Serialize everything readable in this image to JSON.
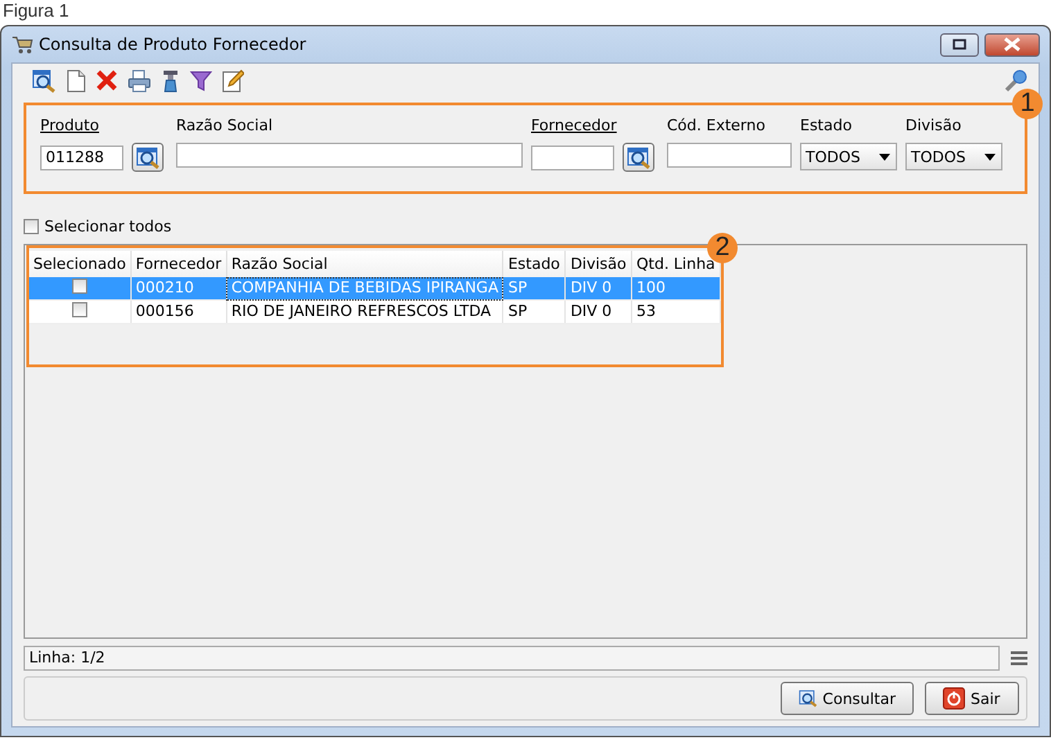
{
  "caption": "Figura 1",
  "window": {
    "title": "Consulta de Produto Fornecedor"
  },
  "filters": {
    "callout": "1",
    "fields": [
      {
        "kind": "lookup",
        "label": "Produto",
        "value": "011288"
      },
      {
        "kind": "text",
        "label": "Razão Social"
      },
      {
        "kind": "lookup",
        "label": "Fornecedor"
      },
      {
        "kind": "text",
        "label": "Cód. Externo"
      },
      {
        "kind": "select",
        "label": "Estado",
        "value": "TODOS"
      },
      {
        "kind": "select",
        "label": "Divisão",
        "value": "TODOS"
      }
    ]
  },
  "select_all": {
    "label": "Selecionar todos",
    "checked": false
  },
  "table": {
    "callout": "2",
    "columns": [
      "Selecionado",
      "Fornecedor",
      "Razão Social",
      "Estado",
      "Divisão",
      "Qtd. Linha"
    ],
    "rows": [
      {
        "selected": true,
        "checked": false,
        "cells": [
          "",
          "000210",
          "COMPANHIA DE BEBIDAS IPIRANGA",
          "SP",
          "DIV 0",
          "100"
        ]
      },
      {
        "selected": false,
        "checked": false,
        "cells": [
          "",
          "000156",
          "RIO DE JANEIRO REFRESCOS LTDA",
          "SP",
          "DIV 0",
          "53"
        ]
      }
    ]
  },
  "status_bar": "Linha: 1/2",
  "buttons": [
    {
      "kind": "search",
      "label": "Consultar"
    },
    {
      "kind": "exit",
      "label": "Sair"
    }
  ]
}
